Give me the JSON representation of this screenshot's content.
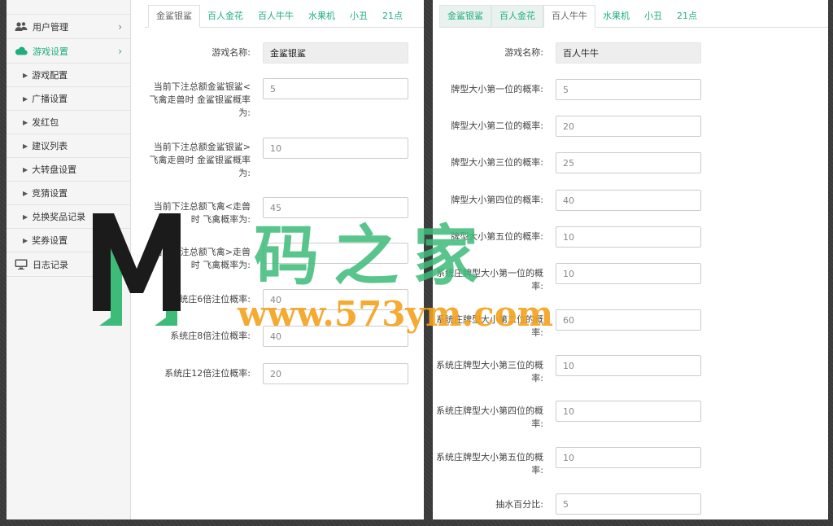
{
  "sidebar": {
    "items": [
      {
        "label": "用户管理",
        "icon": "users-icon",
        "type": "top"
      },
      {
        "label": "游戏设置",
        "icon": "cloud-icon",
        "type": "top",
        "active": true
      },
      {
        "label": "游戏配置",
        "type": "sub"
      },
      {
        "label": "广播设置",
        "type": "sub"
      },
      {
        "label": "发红包",
        "type": "sub"
      },
      {
        "label": "建议列表",
        "type": "sub"
      },
      {
        "label": "大转盘设置",
        "type": "sub"
      },
      {
        "label": "竞猜设置",
        "type": "sub"
      },
      {
        "label": "兑换奖品记录",
        "type": "sub"
      },
      {
        "label": "奖券设置",
        "type": "sub"
      },
      {
        "label": "日志记录",
        "icon": "monitor-icon",
        "type": "top"
      }
    ]
  },
  "left_tabs": [
    {
      "label": "金鲨银鲨",
      "state": "active"
    },
    {
      "label": "百人金花"
    },
    {
      "label": "百人牛牛"
    },
    {
      "label": "水果机"
    },
    {
      "label": "小丑"
    },
    {
      "label": "21点"
    }
  ],
  "right_tabs": [
    {
      "label": "金鲨银鲨",
      "state": "soft"
    },
    {
      "label": "百人金花",
      "state": "soft"
    },
    {
      "label": "百人牛牛",
      "state": "active"
    },
    {
      "label": "水果机"
    },
    {
      "label": "小丑"
    },
    {
      "label": "21点"
    }
  ],
  "left_form": [
    {
      "label": "游戏名称:",
      "value": "金鲨银鲨",
      "readonly": true
    },
    {
      "label": "当前下注总额金鲨银鲨<飞禽走兽时 金鲨银鲨概率为:",
      "value": "5"
    },
    {
      "label": "当前下注总额金鲨银鲨>飞禽走兽时 金鲨银鲨概率为:",
      "value": "10"
    },
    {
      "label": "当前下注总额飞禽<走兽时 飞禽概率为:",
      "value": "45"
    },
    {
      "label": "当前下注总额飞禽>走兽时 飞禽概率为:",
      "value": ""
    },
    {
      "label": "系统庄6倍注位概率:",
      "value": "40"
    },
    {
      "label": "系统庄8倍注位概率:",
      "value": "40"
    },
    {
      "label": "系统庄12倍注位概率:",
      "value": "20"
    }
  ],
  "right_form": [
    {
      "label": "游戏名称:",
      "value": "百人牛牛",
      "readonly": true
    },
    {
      "label": "牌型大小第一位的概率:",
      "value": "5"
    },
    {
      "label": "牌型大小第二位的概率:",
      "value": "20"
    },
    {
      "label": "牌型大小第三位的概率:",
      "value": "25"
    },
    {
      "label": "牌型大小第四位的概率:",
      "value": "40"
    },
    {
      "label": "牌型大小第五位的概率:",
      "value": "10"
    },
    {
      "label": "系统庄牌型大小第一位的概率:",
      "value": "10"
    },
    {
      "label": "系统庄牌型大小第二位的概率:",
      "value": "60"
    },
    {
      "label": "系统庄牌型大小第三位的概率:",
      "value": "10"
    },
    {
      "label": "系统庄牌型大小第四位的概率:",
      "value": "10"
    },
    {
      "label": "系统庄牌型大小第五位的概率:",
      "value": "10"
    },
    {
      "label": "抽水百分比:",
      "value": "5"
    }
  ],
  "watermark": {
    "title": "码之家",
    "url": "www.573ym.com"
  },
  "colors": {
    "accent": "#1fae7c",
    "watermark_orange": "#f5a11c",
    "watermark_green": "#3dbb78"
  }
}
